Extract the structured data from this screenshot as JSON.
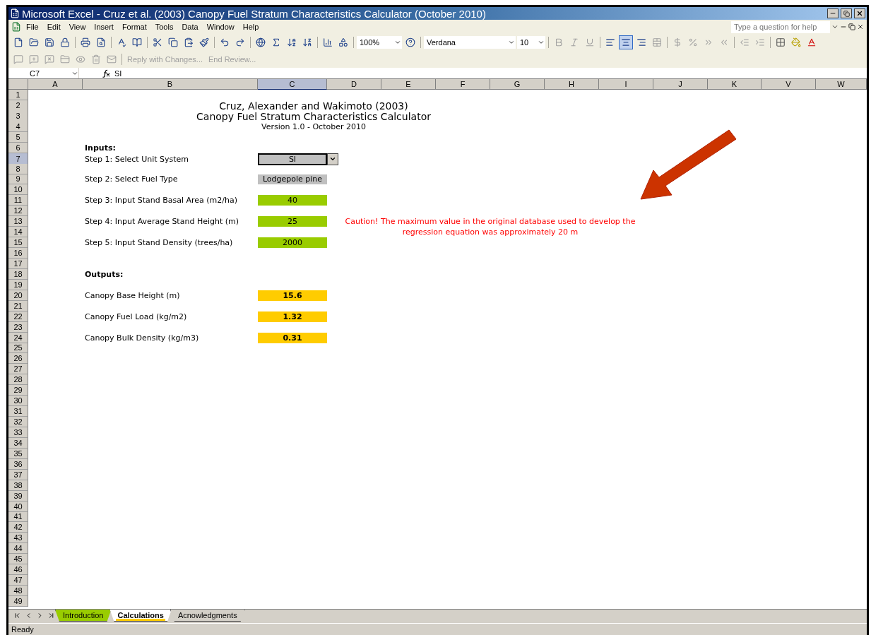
{
  "window": {
    "title": "Microsoft Excel - Cruz et al. (2003) Canopy Fuel Stratum Characteristics Calculator (October 2010)"
  },
  "menu": [
    "File",
    "Edit",
    "View",
    "Insert",
    "Format",
    "Tools",
    "Data",
    "Window",
    "Help"
  ],
  "help_box": {
    "placeholder": "Type a question for help"
  },
  "standard_toolbar": {
    "zoom": "100%"
  },
  "formatting_toolbar": {
    "font": "Verdana",
    "size": "10",
    "align_buttons": [
      {
        "kind": "left",
        "selected": false
      },
      {
        "kind": "center",
        "selected": true
      },
      {
        "kind": "right",
        "selected": false
      }
    ]
  },
  "reviewing_toolbar": {
    "buttons": [
      {
        "label": "Reply with Changes...",
        "disabled": true
      },
      {
        "label": "End Review...",
        "disabled": true
      }
    ]
  },
  "formula_bar": {
    "name_box": "C7",
    "value": "SI"
  },
  "columns": [
    {
      "label": "A",
      "selected": false
    },
    {
      "label": "B",
      "selected": false
    },
    {
      "label": "C",
      "selected": true
    },
    {
      "label": "D",
      "selected": false
    },
    {
      "label": "E",
      "selected": false
    },
    {
      "label": "F",
      "selected": false
    },
    {
      "label": "G",
      "selected": false
    },
    {
      "label": "H",
      "selected": false
    },
    {
      "label": "I",
      "selected": false
    },
    {
      "label": "J",
      "selected": false
    },
    {
      "label": "K",
      "selected": false
    },
    {
      "label": "V",
      "selected": false
    },
    {
      "label": "W",
      "selected": false
    }
  ],
  "rows": [
    {
      "number": "1",
      "selected": false
    },
    {
      "number": "2",
      "selected": false,
      "cells": [
        {
          "kind": "title",
          "text": "Cruz, Alexander and Wakimoto (2003)"
        }
      ]
    },
    {
      "number": "3",
      "selected": false,
      "cells": [
        {
          "kind": "title",
          "text": "Canopy Fuel Stratum Characteristics Calculator"
        }
      ]
    },
    {
      "number": "4",
      "selected": false,
      "cells": [
        {
          "kind": "subtitle",
          "text": "Version 1.0 - October 2010"
        }
      ]
    },
    {
      "number": "5",
      "selected": false
    },
    {
      "number": "6",
      "selected": false,
      "cells": [
        {
          "kind": "heading",
          "text": "Inputs:"
        }
      ]
    },
    {
      "number": "7",
      "selected": true,
      "cells": [
        {
          "kind": "label",
          "text": "Step 1: Select Unit System"
        },
        {
          "kind": "dropdown",
          "text": "SI"
        }
      ]
    },
    {
      "number": "8",
      "selected": false
    },
    {
      "number": "9",
      "selected": false,
      "cells": [
        {
          "kind": "label",
          "text": "Step 2: Select Fuel Type"
        },
        {
          "kind": "gray",
          "text": "Lodgepole pine"
        }
      ]
    },
    {
      "number": "10",
      "selected": false
    },
    {
      "number": "11",
      "selected": false,
      "cells": [
        {
          "kind": "label",
          "text": "Step 3: Input Stand Basal Area (m2/ha)"
        },
        {
          "kind": "input",
          "text": "40"
        }
      ]
    },
    {
      "number": "12",
      "selected": false
    },
    {
      "number": "13",
      "selected": false,
      "cells": [
        {
          "kind": "label",
          "text": "Step 4: Input Average Stand Height (m)"
        },
        {
          "kind": "input",
          "text": "25"
        },
        {
          "kind": "caution",
          "text": "Caution! The maximum value in the original database used to develop the"
        }
      ]
    },
    {
      "number": "14",
      "selected": false,
      "cells": [
        {
          "kind": "caution",
          "text": "regression equation was approximately 20 m"
        }
      ]
    },
    {
      "number": "15",
      "selected": false,
      "cells": [
        {
          "kind": "label",
          "text": "Step 5: Input Stand Density (trees/ha)"
        },
        {
          "kind": "input",
          "text": "2000"
        }
      ]
    },
    {
      "number": "16",
      "selected": false
    },
    {
      "number": "17",
      "selected": false
    },
    {
      "number": "18",
      "selected": false,
      "cells": [
        {
          "kind": "heading",
          "text": "Outputs:"
        }
      ]
    },
    {
      "number": "19",
      "selected": false
    },
    {
      "number": "20",
      "selected": false,
      "cells": [
        {
          "kind": "label",
          "text": "Canopy Base Height (m)"
        },
        {
          "kind": "output",
          "text": "15.6"
        }
      ]
    },
    {
      "number": "21",
      "selected": false
    },
    {
      "number": "22",
      "selected": false,
      "cells": [
        {
          "kind": "label",
          "text": "Canopy Fuel Load (kg/m2)"
        },
        {
          "kind": "output",
          "text": "1.32"
        }
      ]
    },
    {
      "number": "23",
      "selected": false
    },
    {
      "number": "24",
      "selected": false,
      "cells": [
        {
          "kind": "label",
          "text": "Canopy Bulk Density (kg/m3)"
        },
        {
          "kind": "output",
          "text": "0.31"
        }
      ]
    },
    {
      "number": "25",
      "selected": false
    },
    {
      "number": "26",
      "selected": false
    },
    {
      "number": "27",
      "selected": false
    },
    {
      "number": "28",
      "selected": false
    },
    {
      "number": "29",
      "selected": false
    },
    {
      "number": "30",
      "selected": false
    },
    {
      "number": "31",
      "selected": false
    },
    {
      "number": "32",
      "selected": false
    },
    {
      "number": "33",
      "selected": false
    },
    {
      "number": "34",
      "selected": false
    },
    {
      "number": "35",
      "selected": false
    },
    {
      "number": "36",
      "selected": false
    },
    {
      "number": "37",
      "selected": false
    },
    {
      "number": "38",
      "selected": false
    },
    {
      "number": "39",
      "selected": false
    },
    {
      "number": "40",
      "selected": false
    },
    {
      "number": "41",
      "selected": false
    },
    {
      "number": "42",
      "selected": false
    },
    {
      "number": "43",
      "selected": false
    },
    {
      "number": "44",
      "selected": false
    },
    {
      "number": "45",
      "selected": false
    },
    {
      "number": "46",
      "selected": false
    },
    {
      "number": "47",
      "selected": false
    },
    {
      "number": "48",
      "selected": false
    },
    {
      "number": "49",
      "selected": false
    }
  ],
  "sheet_tabs": [
    {
      "label": "Introduction",
      "selected": false,
      "color": "#99cc00"
    },
    {
      "label": "Calculations",
      "selected": true,
      "color": "#ffcc00"
    },
    {
      "label": "Acnowledgments",
      "selected": false
    }
  ],
  "status_bar": {
    "text": "Ready"
  }
}
